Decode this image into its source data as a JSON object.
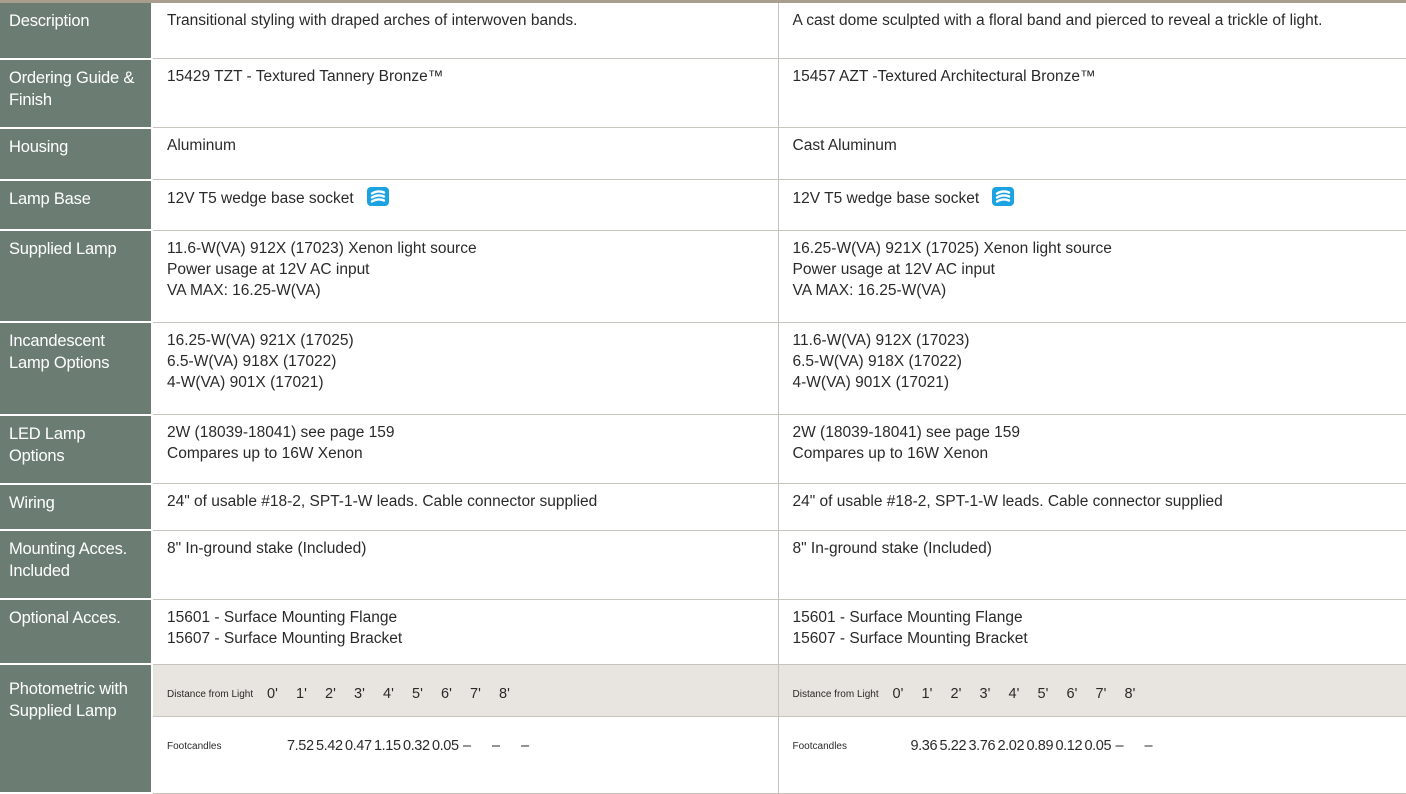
{
  "rows": [
    {
      "label": "Description",
      "col1": [
        "Transitional styling with draped arches of interwoven bands."
      ],
      "col2": [
        "A cast dome sculpted with a floral band and pierced to reveal a trickle of light."
      ]
    },
    {
      "label": "Ordering Guide & Finish",
      "col1": [
        "15429 TZT - Textured Tannery Bronze™"
      ],
      "col2": [
        "15457 AZT -Textured Architectural  Bronze™"
      ]
    },
    {
      "label": "Housing",
      "col1": [
        "Aluminum"
      ],
      "col2": [
        "Cast Aluminum"
      ]
    },
    {
      "label": "Lamp Base",
      "col1": [
        "12V T5 wedge base socket"
      ],
      "col2": [
        "12V T5 wedge base socket"
      ]
    },
    {
      "label": "Supplied Lamp",
      "col1": [
        "11.6-W(VA) 912X (17023) Xenon light source",
        "Power usage at 12V AC input",
        "VA MAX: 16.25-W(VA)"
      ],
      "col2": [
        "16.25-W(VA) 921X (17025) Xenon light source",
        "Power usage at 12V AC input",
        "VA MAX: 16.25-W(VA)"
      ]
    },
    {
      "label": "Incandescent Lamp Options",
      "col1": [
        "16.25-W(VA) 921X (17025)",
        "6.5-W(VA) 918X (17022)",
        "4-W(VA) 901X (17021)"
      ],
      "col2": [
        "11.6-W(VA) 912X (17023)",
        "6.5-W(VA) 918X (17022)",
        "4-W(VA) 901X (17021)"
      ]
    },
    {
      "label": "LED Lamp Options",
      "col1": [
        "2W (18039-18041) see page 159",
        "Compares up to 16W Xenon"
      ],
      "col2": [
        "2W (18039-18041) see page 159",
        "Compares up to 16W Xenon"
      ]
    },
    {
      "label": "Wiring",
      "col1": [
        "24\" of usable #18-2, SPT-1-W leads. Cable connector supplied"
      ],
      "col2": [
        "24\" of usable #18-2, SPT-1-W leads. Cable connector supplied"
      ]
    },
    {
      "label": "Mounting Acces. Included",
      "col1": [
        "8\" In-ground stake (Included)"
      ],
      "col2": [
        "8\" In-ground stake (Included)"
      ]
    },
    {
      "label": "Optional Acces.",
      "col1": [
        "15601 - Surface Mounting Flange",
        "15607 - Surface Mounting Bracket"
      ],
      "col2": [
        "15601 - Surface Mounting Flange",
        "15607 - Surface Mounting Bracket"
      ]
    }
  ],
  "photometric": {
    "label": "Photometric with Supplied Lamp",
    "distance_label": "Distance from Light",
    "footcandles_label": "Footcandles",
    "distances": [
      "0'",
      "1'",
      "2'",
      "3'",
      "4'",
      "5'",
      "6'",
      "7'",
      "8'"
    ],
    "col1_footcandles": [
      "7.52",
      "5.42",
      "0.47",
      "1.15",
      "0.32",
      "0.05",
      "–",
      "–",
      "–"
    ],
    "col2_footcandles": [
      "9.36",
      "5.22",
      "3.76",
      "2.02",
      "0.89",
      "0.12",
      "0.05",
      "–",
      "–"
    ]
  },
  "icons": {
    "lamp_base": "bi-pin-bulb-icon"
  },
  "colors": {
    "label_bg": "#6b7d72",
    "photometric_band": "#e8e4df",
    "icon_blue": "#1aa3e0"
  }
}
